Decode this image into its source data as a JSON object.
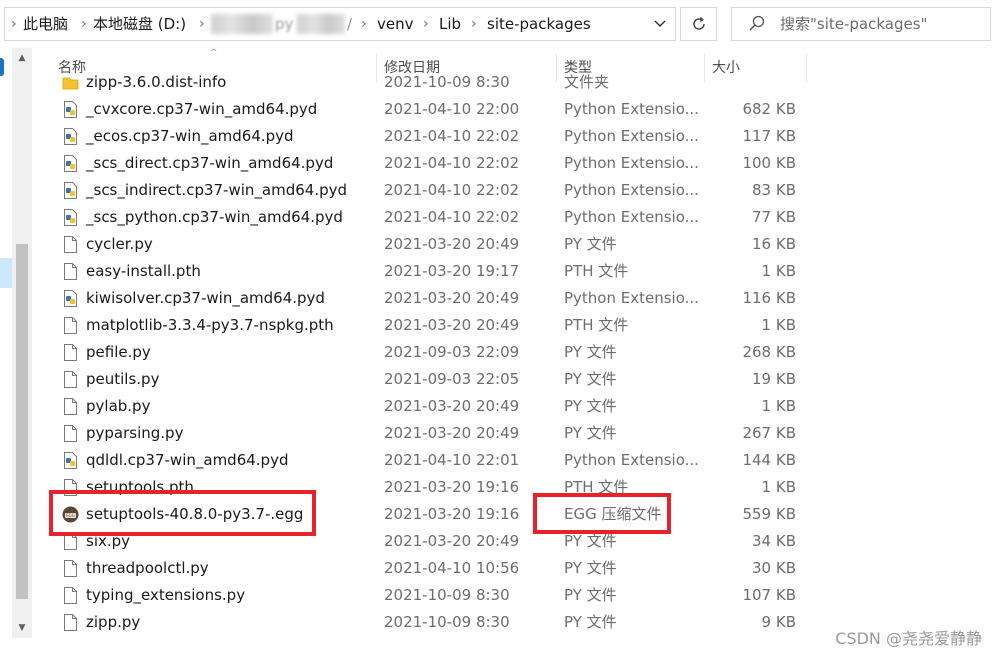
{
  "address_bar": {
    "crumbs": [
      "此电脑",
      "本地磁盘 (D:)",
      "venv",
      "Lib",
      "site-packages"
    ],
    "blurred_fragment_a": "py",
    "blurred_fragment_b": "/"
  },
  "search": {
    "placeholder": "搜索\"site-packages\""
  },
  "columns": {
    "name": "名称",
    "date": "修改日期",
    "type": "类型",
    "size": "大小"
  },
  "files": [
    {
      "name": "zipp-3.6.0.dist-info",
      "date": "2021-10-09 8:30",
      "type": "文件夹",
      "size": "",
      "icon": "folder-icon"
    },
    {
      "name": "_cvxcore.cp37-win_amd64.pyd",
      "date": "2021-04-10 22:00",
      "type": "Python Extensio...",
      "size": "682 KB",
      "icon": "python-file-icon"
    },
    {
      "name": "_ecos.cp37-win_amd64.pyd",
      "date": "2021-04-10 22:02",
      "type": "Python Extensio...",
      "size": "117 KB",
      "icon": "python-file-icon"
    },
    {
      "name": "_scs_direct.cp37-win_amd64.pyd",
      "date": "2021-04-10 22:02",
      "type": "Python Extensio...",
      "size": "100 KB",
      "icon": "python-file-icon"
    },
    {
      "name": "_scs_indirect.cp37-win_amd64.pyd",
      "date": "2021-04-10 22:02",
      "type": "Python Extensio...",
      "size": "83 KB",
      "icon": "python-file-icon"
    },
    {
      "name": "_scs_python.cp37-win_amd64.pyd",
      "date": "2021-04-10 22:02",
      "type": "Python Extensio...",
      "size": "77 KB",
      "icon": "python-file-icon"
    },
    {
      "name": "cycler.py",
      "date": "2021-03-20 20:49",
      "type": "PY 文件",
      "size": "16 KB",
      "icon": "file-icon"
    },
    {
      "name": "easy-install.pth",
      "date": "2021-03-20 19:17",
      "type": "PTH 文件",
      "size": "1 KB",
      "icon": "file-icon"
    },
    {
      "name": "kiwisolver.cp37-win_amd64.pyd",
      "date": "2021-03-20 20:49",
      "type": "Python Extensio...",
      "size": "116 KB",
      "icon": "python-file-icon"
    },
    {
      "name": "matplotlib-3.3.4-py3.7-nspkg.pth",
      "date": "2021-03-20 20:49",
      "type": "PTH 文件",
      "size": "1 KB",
      "icon": "file-icon"
    },
    {
      "name": "pefile.py",
      "date": "2021-09-03 22:09",
      "type": "PY 文件",
      "size": "268 KB",
      "icon": "file-icon"
    },
    {
      "name": "peutils.py",
      "date": "2021-09-03 22:05",
      "type": "PY 文件",
      "size": "19 KB",
      "icon": "file-icon"
    },
    {
      "name": "pylab.py",
      "date": "2021-03-20 20:49",
      "type": "PY 文件",
      "size": "1 KB",
      "icon": "file-icon"
    },
    {
      "name": "pyparsing.py",
      "date": "2021-03-20 20:49",
      "type": "PY 文件",
      "size": "267 KB",
      "icon": "file-icon"
    },
    {
      "name": "qdldl.cp37-win_amd64.pyd",
      "date": "2021-04-10 22:01",
      "type": "Python Extensio...",
      "size": "144 KB",
      "icon": "python-file-icon"
    },
    {
      "name": "setuptools.pth",
      "date": "2021-03-20 19:16",
      "type": "PTH 文件",
      "size": "1 KB",
      "icon": "file-icon"
    },
    {
      "name": "setuptools-40.8.0-py3.7-.egg",
      "date": "2021-03-20 19:16",
      "type": "EGG 压缩文件",
      "size": "559 KB",
      "icon": "egg-archive-icon",
      "highlighted": true
    },
    {
      "name": "six.py",
      "date": "2021-03-20 20:49",
      "type": "PY 文件",
      "size": "34 KB",
      "icon": "file-icon"
    },
    {
      "name": "threadpoolctl.py",
      "date": "2021-04-10 10:56",
      "type": "PY 文件",
      "size": "30 KB",
      "icon": "file-icon"
    },
    {
      "name": "typing_extensions.py",
      "date": "2021-10-09 8:30",
      "type": "PY 文件",
      "size": "107 KB",
      "icon": "file-icon"
    },
    {
      "name": "zipp.py",
      "date": "2021-10-09 8:30",
      "type": "PY 文件",
      "size": "9 KB",
      "icon": "file-icon"
    }
  ],
  "highlight_color": "#e8222a",
  "selection_color": "#cce8ff",
  "watermark": "CSDN @尧尧爱静静"
}
